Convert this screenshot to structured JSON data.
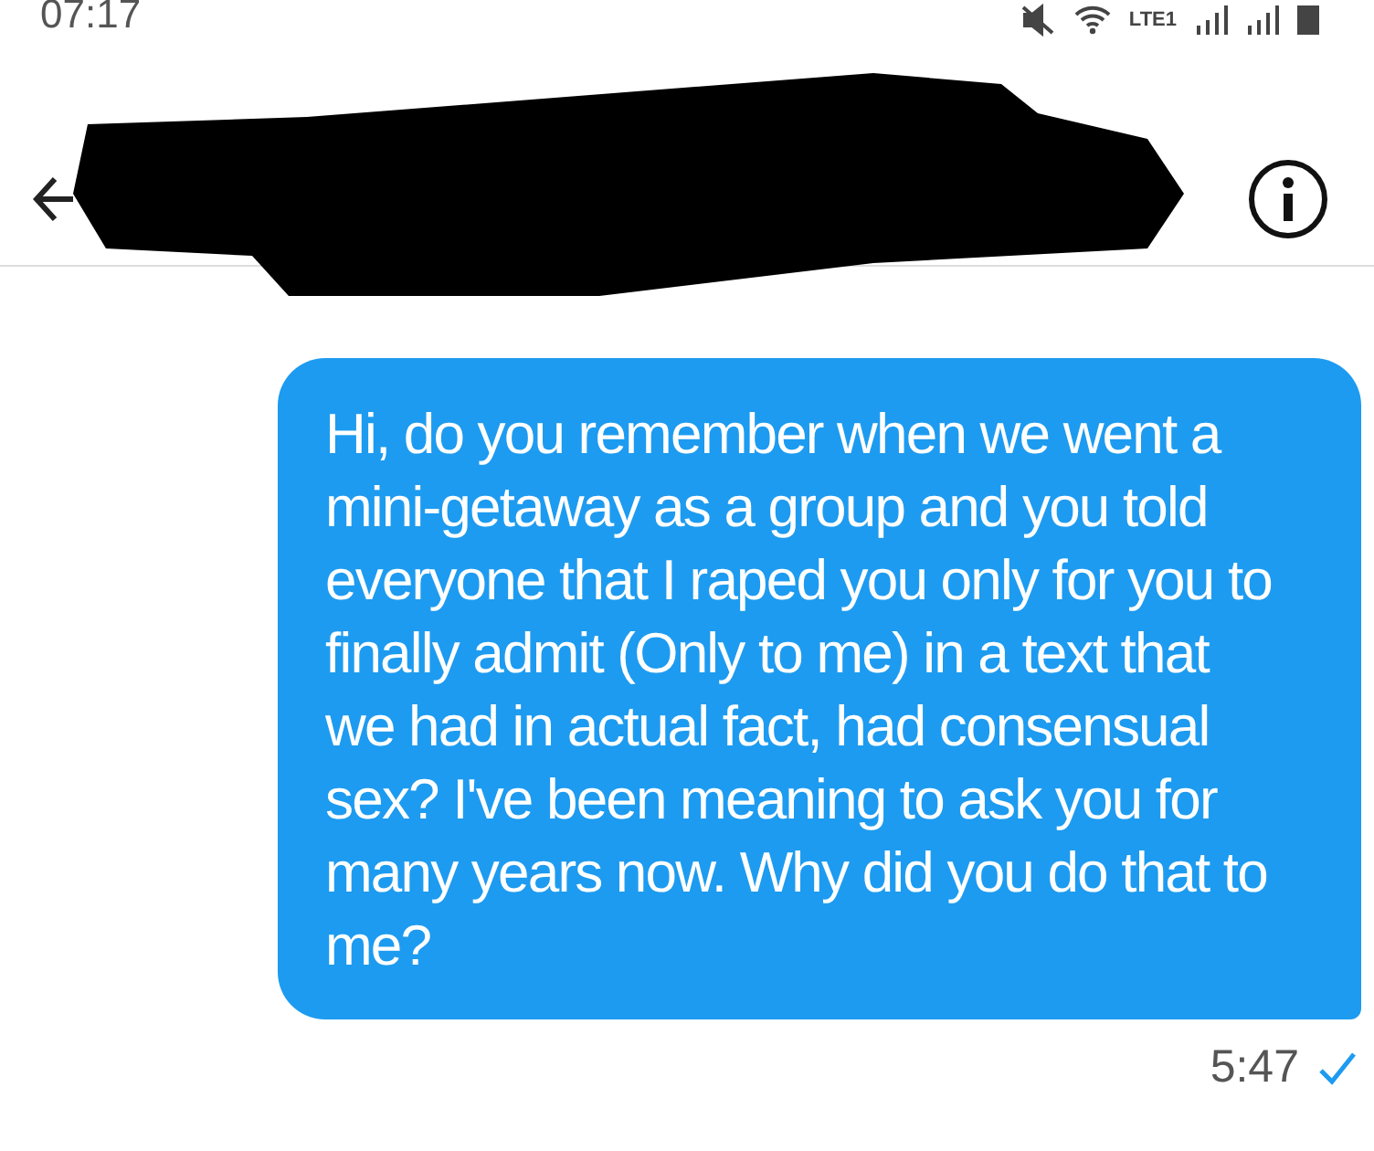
{
  "status_bar": {
    "time": "07:17",
    "network": "LTE1"
  },
  "header": {
    "redacted": true
  },
  "messages": [
    {
      "text": "Hi, do you remember when we went a mini-getaway as a group and you told everyone that I raped you only for you to finally admit (Only to me) in a text that we had in actual fact, had consensual sex? I've been meaning to ask you for many years now. Why did you do that to me?",
      "time": "5:47",
      "sent": true
    }
  ]
}
